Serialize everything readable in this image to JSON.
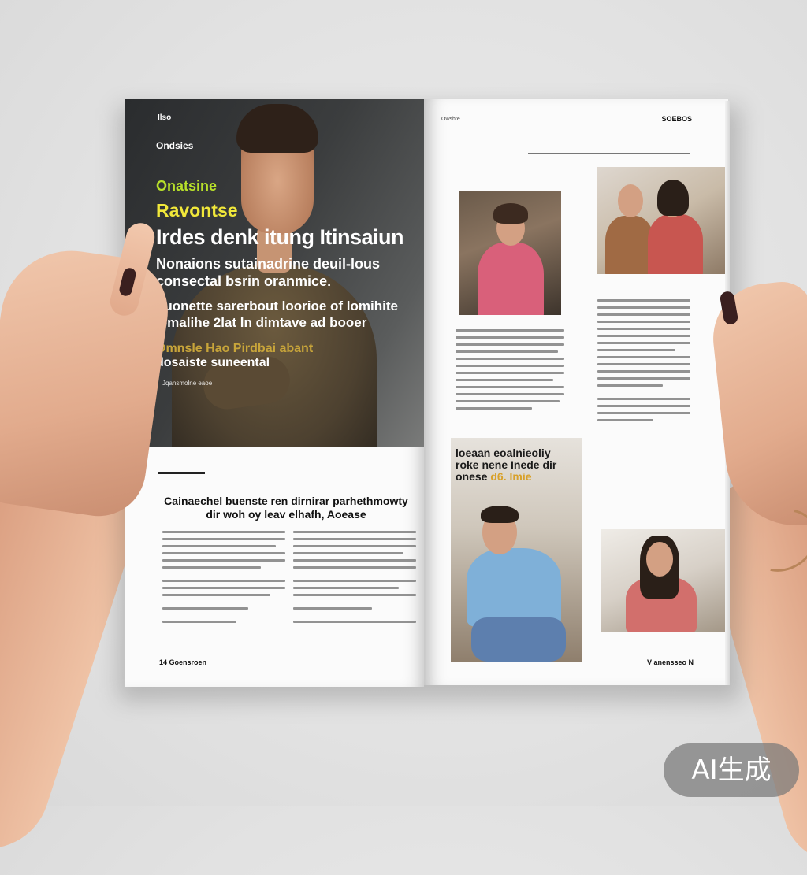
{
  "left_page": {
    "hero": {
      "tiny_label": "Ilso",
      "small_label": "Ondsies",
      "kicker_lime": "Onatsine",
      "kicker_yellow": "Ravontse",
      "headline": "Irdes denk itung Itinsaiun",
      "paragraph_1": "Nonaions sutainadrine deuil-lous consectal bsrin oranmice.",
      "paragraph_2": "Luonette sarerbout loorioe of lomihite lemalihe 2lat ln dimtave ad booer",
      "accent_line": "Omnsle Hao Pirdbai abant",
      "sub_line": "dosaiste suneental",
      "credit": "Jqansmolne eaoe"
    },
    "section_title": "Cainaechel buenste ren dirnirar parhethmowty dir woh oy leav elhafh, Aoease",
    "folio": "14 Goensroen"
  },
  "right_page": {
    "header": "SOEBOS",
    "side_label": "Owshte",
    "photo_caption_line1": "loeaan eoalnieoliy",
    "photo_caption_line2": "roke nene Inede dir",
    "photo_caption_line3": "onese",
    "photo_caption_accent": "d6. Imie",
    "folio": "V anensseo N"
  },
  "badge": {
    "text": "AI生成"
  },
  "colors": {
    "lime": "#b8e02a",
    "yellow": "#f1e83a",
    "accent_gold": "#c8a53a",
    "background": "#e6e6e6"
  }
}
